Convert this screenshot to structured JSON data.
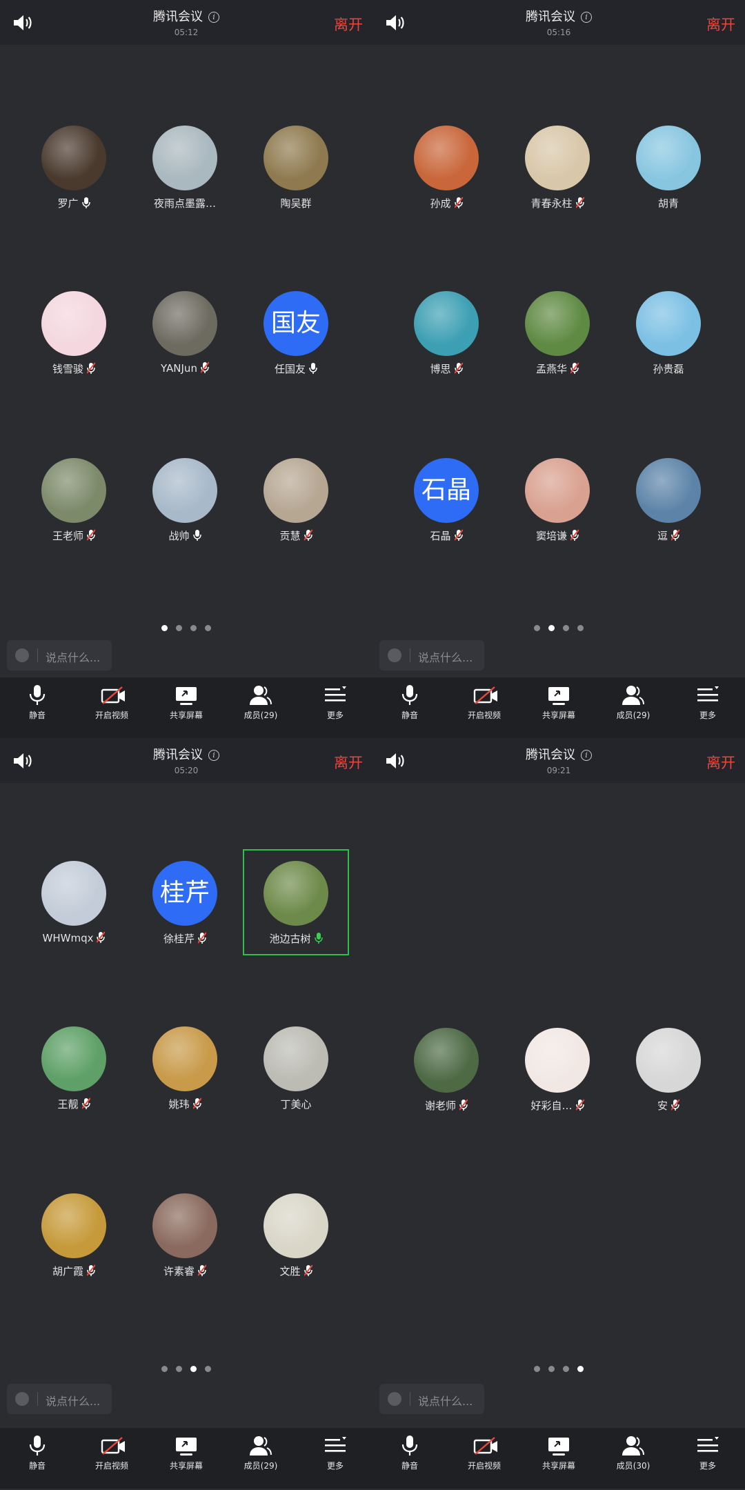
{
  "panels": [
    {
      "title": "腾讯会议",
      "timer": "05:12",
      "leave": "离开",
      "page_dots": 4,
      "active_dot": 0,
      "members": [
        {
          "name": "罗广",
          "avatar": "photo",
          "color": "#4a3a2e",
          "mic": "active-white"
        },
        {
          "name": "夜雨点墨露…",
          "avatar": "photo",
          "color": "#aab8bf",
          "mic": "none"
        },
        {
          "name": "陶吴群",
          "avatar": "photo",
          "color": "#8f7a4f",
          "mic": "none"
        },
        {
          "name": "钱雪骏",
          "avatar": "photo",
          "color": "#f4d7df",
          "mic": "muted"
        },
        {
          "name": "YANJun",
          "avatar": "photo",
          "color": "#6d6b60",
          "mic": "muted"
        },
        {
          "name": "任国友",
          "avatar": "text",
          "text": "国友",
          "mic": "active-white"
        },
        {
          "name": "王老师",
          "avatar": "photo",
          "color": "#7c8a6a",
          "mic": "muted"
        },
        {
          "name": "战帅",
          "avatar": "photo",
          "color": "#a8b9c9",
          "mic": "active-white"
        },
        {
          "name": "贡慧",
          "avatar": "photo",
          "color": "#b6a793",
          "mic": "muted"
        }
      ],
      "toolbar": [
        {
          "label": "静音",
          "icon": "mic-icon"
        },
        {
          "label": "开启视频",
          "icon": "video-off-icon"
        },
        {
          "label": "共享屏幕",
          "icon": "share-screen-icon"
        },
        {
          "label": "成员(29)",
          "icon": "members-icon"
        },
        {
          "label": "更多",
          "icon": "more-icon"
        }
      ],
      "chat_placeholder": "说点什么..."
    },
    {
      "title": "腾讯会议",
      "timer": "05:16",
      "leave": "离开",
      "page_dots": 4,
      "active_dot": 1,
      "members": [
        {
          "name": "孙成",
          "avatar": "photo",
          "color": "#c9663a",
          "mic": "muted"
        },
        {
          "name": "青春永柱",
          "avatar": "photo",
          "color": "#d8c7a9",
          "mic": "muted"
        },
        {
          "name": "胡青",
          "avatar": "photo",
          "color": "#88c6e0",
          "mic": "none"
        },
        {
          "name": "博思",
          "avatar": "photo",
          "color": "#3d9fb3",
          "mic": "muted"
        },
        {
          "name": "孟燕华",
          "avatar": "photo",
          "color": "#5f8a43",
          "mic": "muted"
        },
        {
          "name": "孙贵磊",
          "avatar": "photo",
          "color": "#7cc0e4",
          "mic": "none"
        },
        {
          "name": "石晶",
          "avatar": "text",
          "text": "石晶",
          "mic": "muted"
        },
        {
          "name": "窦培谦",
          "avatar": "photo",
          "color": "#d9a190",
          "mic": "muted"
        },
        {
          "name": "逗",
          "avatar": "photo",
          "color": "#5d84a8",
          "mic": "muted"
        }
      ],
      "toolbar": [
        {
          "label": "静音",
          "icon": "mic-icon"
        },
        {
          "label": "开启视频",
          "icon": "video-off-icon"
        },
        {
          "label": "共享屏幕",
          "icon": "share-screen-icon"
        },
        {
          "label": "成员(29)",
          "icon": "members-icon"
        },
        {
          "label": "更多",
          "icon": "more-icon"
        }
      ],
      "chat_placeholder": "说点什么..."
    },
    {
      "title": "腾讯会议",
      "timer": "05:20",
      "leave": "离开",
      "page_dots": 4,
      "active_dot": 2,
      "members": [
        {
          "name": "WHWmqx",
          "avatar": "photo",
          "color": "#c3ccd8",
          "mic": "muted"
        },
        {
          "name": "徐桂芹",
          "avatar": "text",
          "text": "桂芹",
          "mic": "muted"
        },
        {
          "name": "池边古树",
          "avatar": "photo",
          "color": "#6e8a4a",
          "mic": "active-green",
          "highlight": true
        },
        {
          "name": "王靓",
          "avatar": "photo",
          "color": "#5ea067",
          "mic": "muted"
        },
        {
          "name": "姚玮",
          "avatar": "photo",
          "color": "#c89a4a",
          "mic": "muted"
        },
        {
          "name": "丁美心",
          "avatar": "photo",
          "color": "#bcbcb4",
          "mic": "none"
        },
        {
          "name": "胡广霞",
          "avatar": "photo",
          "color": "#c69a3b",
          "mic": "muted"
        },
        {
          "name": "许素睿",
          "avatar": "photo",
          "color": "#8a6a5e",
          "mic": "muted"
        },
        {
          "name": "文胜",
          "avatar": "photo",
          "color": "#d9d6c8",
          "mic": "muted"
        }
      ],
      "toolbar": [
        {
          "label": "静音",
          "icon": "mic-icon"
        },
        {
          "label": "开启视频",
          "icon": "video-off-icon"
        },
        {
          "label": "共享屏幕",
          "icon": "share-screen-icon"
        },
        {
          "label": "成员(29)",
          "icon": "members-icon"
        },
        {
          "label": "更多",
          "icon": "more-icon"
        }
      ],
      "chat_placeholder": "说点什么..."
    },
    {
      "title": "腾讯会议",
      "timer": "09:21",
      "leave": "离开",
      "page_dots": 4,
      "active_dot": 3,
      "members": [
        {
          "name": "谢老师",
          "avatar": "photo",
          "color": "#4e6a45",
          "mic": "muted"
        },
        {
          "name": "好彩自…",
          "avatar": "photo",
          "color": "#f1e8e4",
          "mic": "muted"
        },
        {
          "name": "安",
          "avatar": "photo",
          "color": "#d7d7d7",
          "mic": "muted"
        }
      ],
      "toolbar": [
        {
          "label": "静音",
          "icon": "mic-icon"
        },
        {
          "label": "开启视频",
          "icon": "video-off-icon"
        },
        {
          "label": "共享屏幕",
          "icon": "share-screen-icon"
        },
        {
          "label": "成员(30)",
          "icon": "members-icon"
        },
        {
          "label": "更多",
          "icon": "more-icon"
        }
      ],
      "chat_placeholder": "说点什么..."
    }
  ]
}
